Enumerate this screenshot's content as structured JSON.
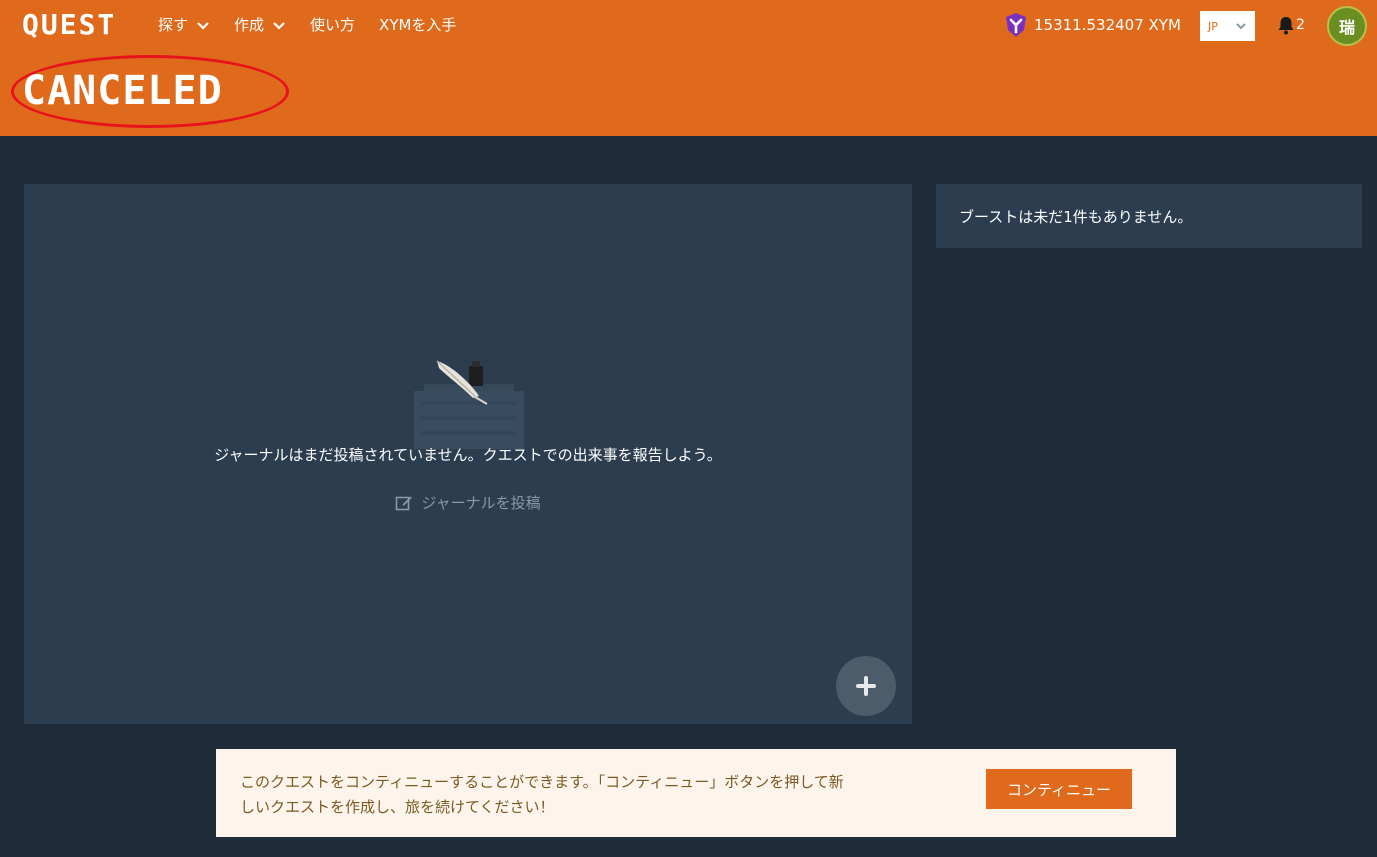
{
  "header": {
    "logo": "QUEST",
    "nav": [
      {
        "label": "探す",
        "has_dropdown": true
      },
      {
        "label": "作成",
        "has_dropdown": true
      },
      {
        "label": "使い方",
        "has_dropdown": false
      },
      {
        "label": "XYMを入手",
        "has_dropdown": false
      }
    ],
    "balance": "15311.532407 XYM",
    "language": "JP",
    "notification_count": "2",
    "avatar_initial": "瑞",
    "accent_color": "#e06a1b"
  },
  "status": {
    "label": "CANCELED",
    "annotation_color": "#e8121d"
  },
  "journal": {
    "empty_message": "ジャーナルはまだ投稿されていません。クエストでの出来事を報告しよう。",
    "post_label": "ジャーナルを投稿"
  },
  "boost": {
    "empty_message": "ブーストは未だ1件もありません。"
  },
  "notice": {
    "message_line1": "このクエストをコンティニューすることができます。「コンティニュー」ボタンを押して新",
    "message_line2": "しいクエストを作成し、旅を続けてください！",
    "button_label": "コンティニュー"
  },
  "icons": {
    "nav_dropdown": "chevron-down-icon",
    "wallet": "symbol-xym-icon",
    "bell": "bell-icon",
    "edit": "edit-icon",
    "add": "plus-icon",
    "illustration": "quill-ink-icon"
  }
}
